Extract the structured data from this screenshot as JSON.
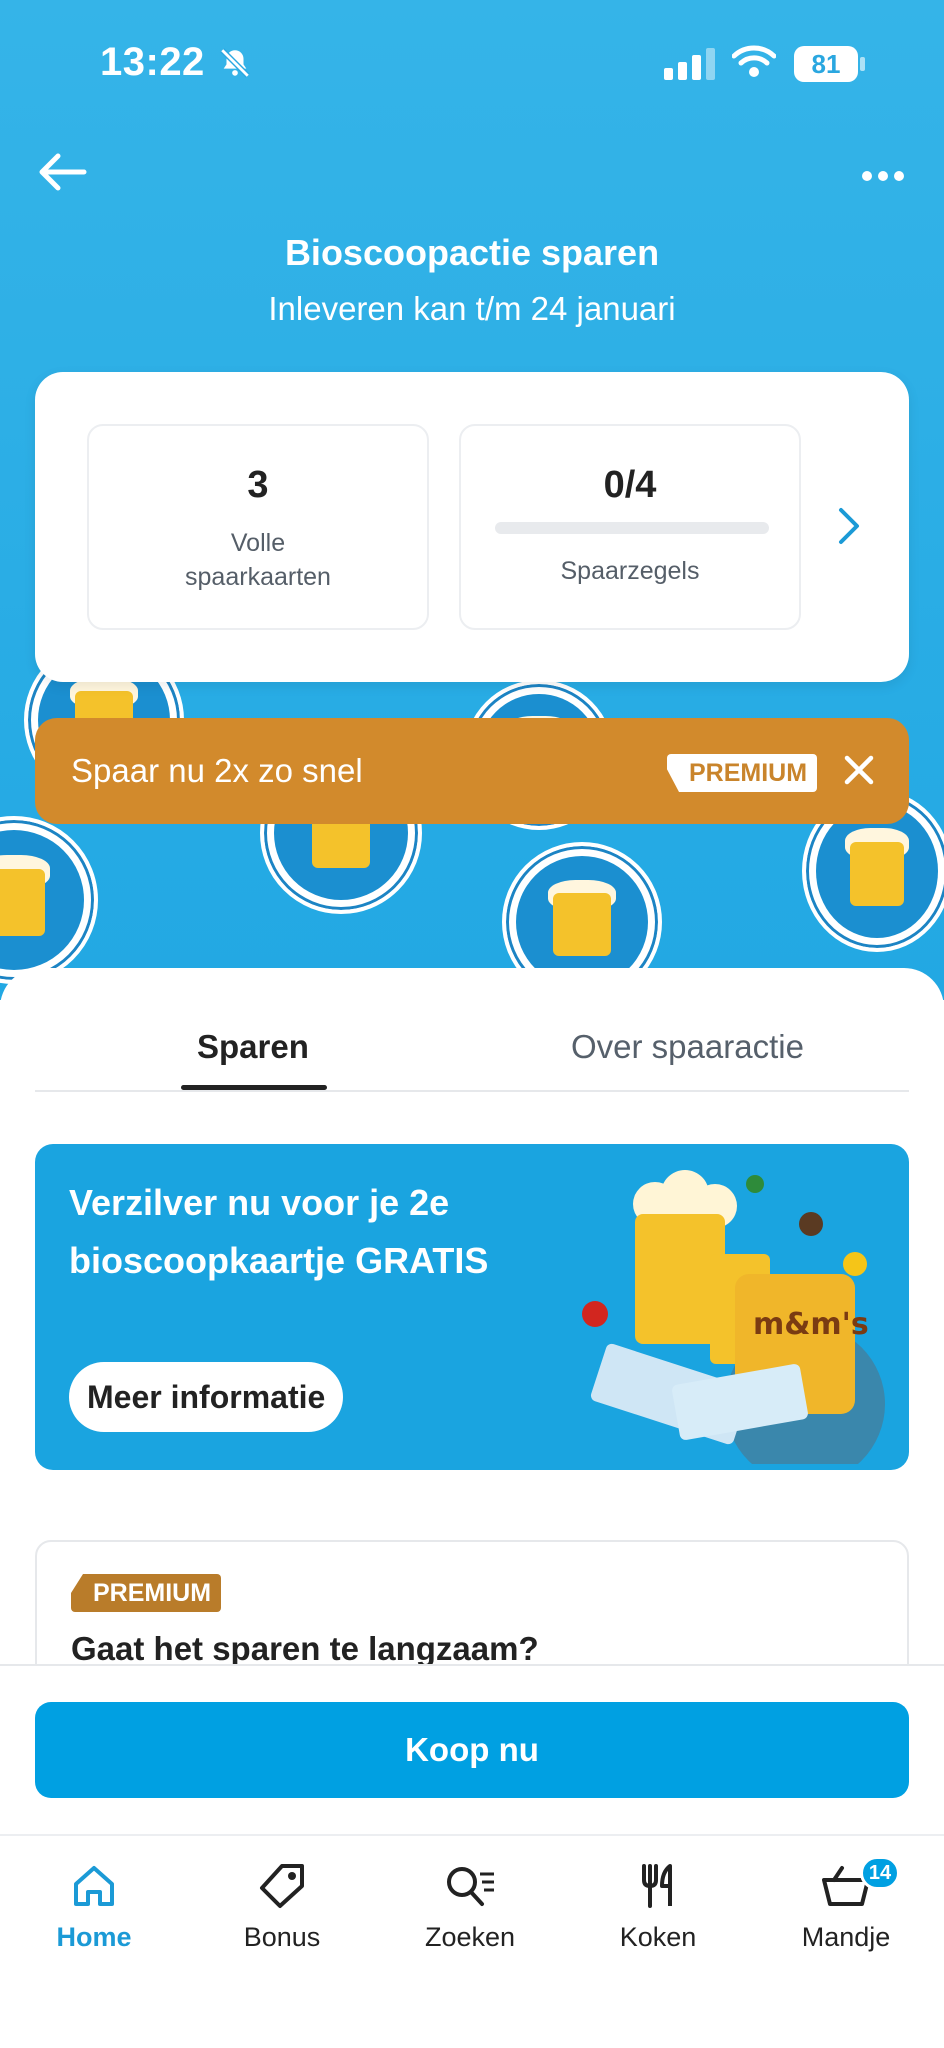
{
  "status_bar": {
    "time": "13:22",
    "battery": "81"
  },
  "header": {
    "title": "Bioscoopactie sparen",
    "subtitle": "Inleveren kan t/m 24 januari"
  },
  "summary": {
    "full_cards": {
      "value": "3",
      "label": "Volle spaarkaarten"
    },
    "stamps": {
      "value": "0/4",
      "label": "Spaarzegels",
      "progress_fraction": 0
    }
  },
  "premium_banner": {
    "text": "Spaar nu 2x zo snel",
    "tag": "PREMIUM"
  },
  "tabs": {
    "active": "Sparen",
    "other": "Over spaaractie"
  },
  "promo": {
    "title": "Verzilver nu voor je 2e bioscoopkaartje GRATIS",
    "button": "Meer informatie"
  },
  "premium_card": {
    "chip": "PREMIUM",
    "title": "Gaat het sparen te langzaam?"
  },
  "buy": {
    "label": "Koop nu"
  },
  "tabbar": {
    "items": [
      {
        "label": "Home",
        "icon": "home-icon"
      },
      {
        "label": "Bonus",
        "icon": "tag-icon"
      },
      {
        "label": "Zoeken",
        "icon": "search-icon"
      },
      {
        "label": "Koken",
        "icon": "cutlery-icon"
      },
      {
        "label": "Mandje",
        "icon": "basket-icon"
      }
    ],
    "cart_count": "14"
  },
  "colors": {
    "hero": "#2aa8e2",
    "accent": "#00a0e2",
    "premium": "#d28a2c"
  }
}
